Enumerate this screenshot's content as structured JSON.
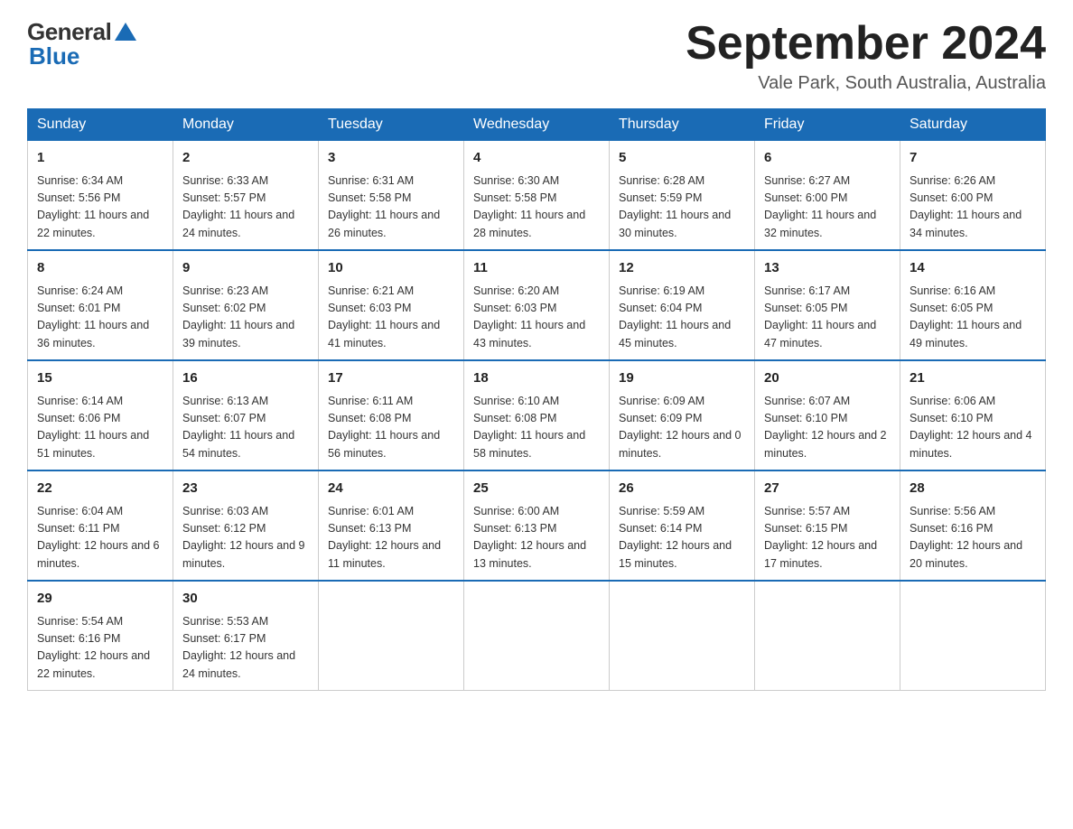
{
  "logo": {
    "general": "General",
    "blue": "Blue"
  },
  "title": {
    "month_year": "September 2024",
    "location": "Vale Park, South Australia, Australia"
  },
  "days_of_week": [
    "Sunday",
    "Monday",
    "Tuesday",
    "Wednesday",
    "Thursday",
    "Friday",
    "Saturday"
  ],
  "weeks": [
    [
      {
        "day": "1",
        "sunrise": "6:34 AM",
        "sunset": "5:56 PM",
        "daylight": "11 hours and 22 minutes."
      },
      {
        "day": "2",
        "sunrise": "6:33 AM",
        "sunset": "5:57 PM",
        "daylight": "11 hours and 24 minutes."
      },
      {
        "day": "3",
        "sunrise": "6:31 AM",
        "sunset": "5:58 PM",
        "daylight": "11 hours and 26 minutes."
      },
      {
        "day": "4",
        "sunrise": "6:30 AM",
        "sunset": "5:58 PM",
        "daylight": "11 hours and 28 minutes."
      },
      {
        "day": "5",
        "sunrise": "6:28 AM",
        "sunset": "5:59 PM",
        "daylight": "11 hours and 30 minutes."
      },
      {
        "day": "6",
        "sunrise": "6:27 AM",
        "sunset": "6:00 PM",
        "daylight": "11 hours and 32 minutes."
      },
      {
        "day": "7",
        "sunrise": "6:26 AM",
        "sunset": "6:00 PM",
        "daylight": "11 hours and 34 minutes."
      }
    ],
    [
      {
        "day": "8",
        "sunrise": "6:24 AM",
        "sunset": "6:01 PM",
        "daylight": "11 hours and 36 minutes."
      },
      {
        "day": "9",
        "sunrise": "6:23 AM",
        "sunset": "6:02 PM",
        "daylight": "11 hours and 39 minutes."
      },
      {
        "day": "10",
        "sunrise": "6:21 AM",
        "sunset": "6:03 PM",
        "daylight": "11 hours and 41 minutes."
      },
      {
        "day": "11",
        "sunrise": "6:20 AM",
        "sunset": "6:03 PM",
        "daylight": "11 hours and 43 minutes."
      },
      {
        "day": "12",
        "sunrise": "6:19 AM",
        "sunset": "6:04 PM",
        "daylight": "11 hours and 45 minutes."
      },
      {
        "day": "13",
        "sunrise": "6:17 AM",
        "sunset": "6:05 PM",
        "daylight": "11 hours and 47 minutes."
      },
      {
        "day": "14",
        "sunrise": "6:16 AM",
        "sunset": "6:05 PM",
        "daylight": "11 hours and 49 minutes."
      }
    ],
    [
      {
        "day": "15",
        "sunrise": "6:14 AM",
        "sunset": "6:06 PM",
        "daylight": "11 hours and 51 minutes."
      },
      {
        "day": "16",
        "sunrise": "6:13 AM",
        "sunset": "6:07 PM",
        "daylight": "11 hours and 54 minutes."
      },
      {
        "day": "17",
        "sunrise": "6:11 AM",
        "sunset": "6:08 PM",
        "daylight": "11 hours and 56 minutes."
      },
      {
        "day": "18",
        "sunrise": "6:10 AM",
        "sunset": "6:08 PM",
        "daylight": "11 hours and 58 minutes."
      },
      {
        "day": "19",
        "sunrise": "6:09 AM",
        "sunset": "6:09 PM",
        "daylight": "12 hours and 0 minutes."
      },
      {
        "day": "20",
        "sunrise": "6:07 AM",
        "sunset": "6:10 PM",
        "daylight": "12 hours and 2 minutes."
      },
      {
        "day": "21",
        "sunrise": "6:06 AM",
        "sunset": "6:10 PM",
        "daylight": "12 hours and 4 minutes."
      }
    ],
    [
      {
        "day": "22",
        "sunrise": "6:04 AM",
        "sunset": "6:11 PM",
        "daylight": "12 hours and 6 minutes."
      },
      {
        "day": "23",
        "sunrise": "6:03 AM",
        "sunset": "6:12 PM",
        "daylight": "12 hours and 9 minutes."
      },
      {
        "day": "24",
        "sunrise": "6:01 AM",
        "sunset": "6:13 PM",
        "daylight": "12 hours and 11 minutes."
      },
      {
        "day": "25",
        "sunrise": "6:00 AM",
        "sunset": "6:13 PM",
        "daylight": "12 hours and 13 minutes."
      },
      {
        "day": "26",
        "sunrise": "5:59 AM",
        "sunset": "6:14 PM",
        "daylight": "12 hours and 15 minutes."
      },
      {
        "day": "27",
        "sunrise": "5:57 AM",
        "sunset": "6:15 PM",
        "daylight": "12 hours and 17 minutes."
      },
      {
        "day": "28",
        "sunrise": "5:56 AM",
        "sunset": "6:16 PM",
        "daylight": "12 hours and 20 minutes."
      }
    ],
    [
      {
        "day": "29",
        "sunrise": "5:54 AM",
        "sunset": "6:16 PM",
        "daylight": "12 hours and 22 minutes."
      },
      {
        "day": "30",
        "sunrise": "5:53 AM",
        "sunset": "6:17 PM",
        "daylight": "12 hours and 24 minutes."
      },
      null,
      null,
      null,
      null,
      null
    ]
  ]
}
